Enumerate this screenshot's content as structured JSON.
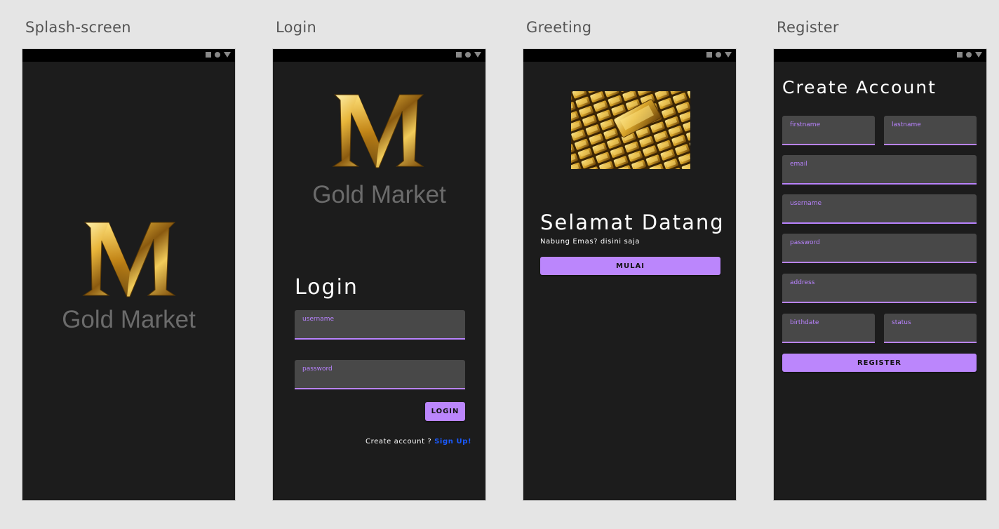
{
  "frames": {
    "splash": {
      "title": "Splash-screen"
    },
    "login": {
      "title": "Login"
    },
    "greeting": {
      "title": "Greeting"
    },
    "register": {
      "title": "Register"
    }
  },
  "brand": {
    "name": "Gold Market",
    "logo_letter": "M"
  },
  "login": {
    "heading": "Login",
    "username_label": "username",
    "password_label": "password",
    "login_button": "LOGIN",
    "create_account_text": "Create account ?",
    "signup_link": "Sign Up!"
  },
  "greeting": {
    "heading": "Selamat Datang",
    "subtitle": "Nabung Emas? disini saja",
    "start_button": "MULAI"
  },
  "register": {
    "heading": "Create Account",
    "firstname_label": "firstname",
    "lastname_label": "lastname",
    "email_label": "email",
    "username_label": "username",
    "password_label": "password",
    "address_label": "address",
    "birthdate_label": "birthdate",
    "status_label": "status",
    "register_button": "REGISTER"
  },
  "colors": {
    "background": "#e5e5e5",
    "screen": "#1c1c1c",
    "accent": "#bb86fc",
    "field": "#484848",
    "link": "#1a5aff",
    "gold": "#d4a017"
  },
  "icons": [
    "stop-square-icon",
    "home-circle-icon",
    "back-triangle-icon",
    "gold-m-logo",
    "gold-bars-image"
  ]
}
